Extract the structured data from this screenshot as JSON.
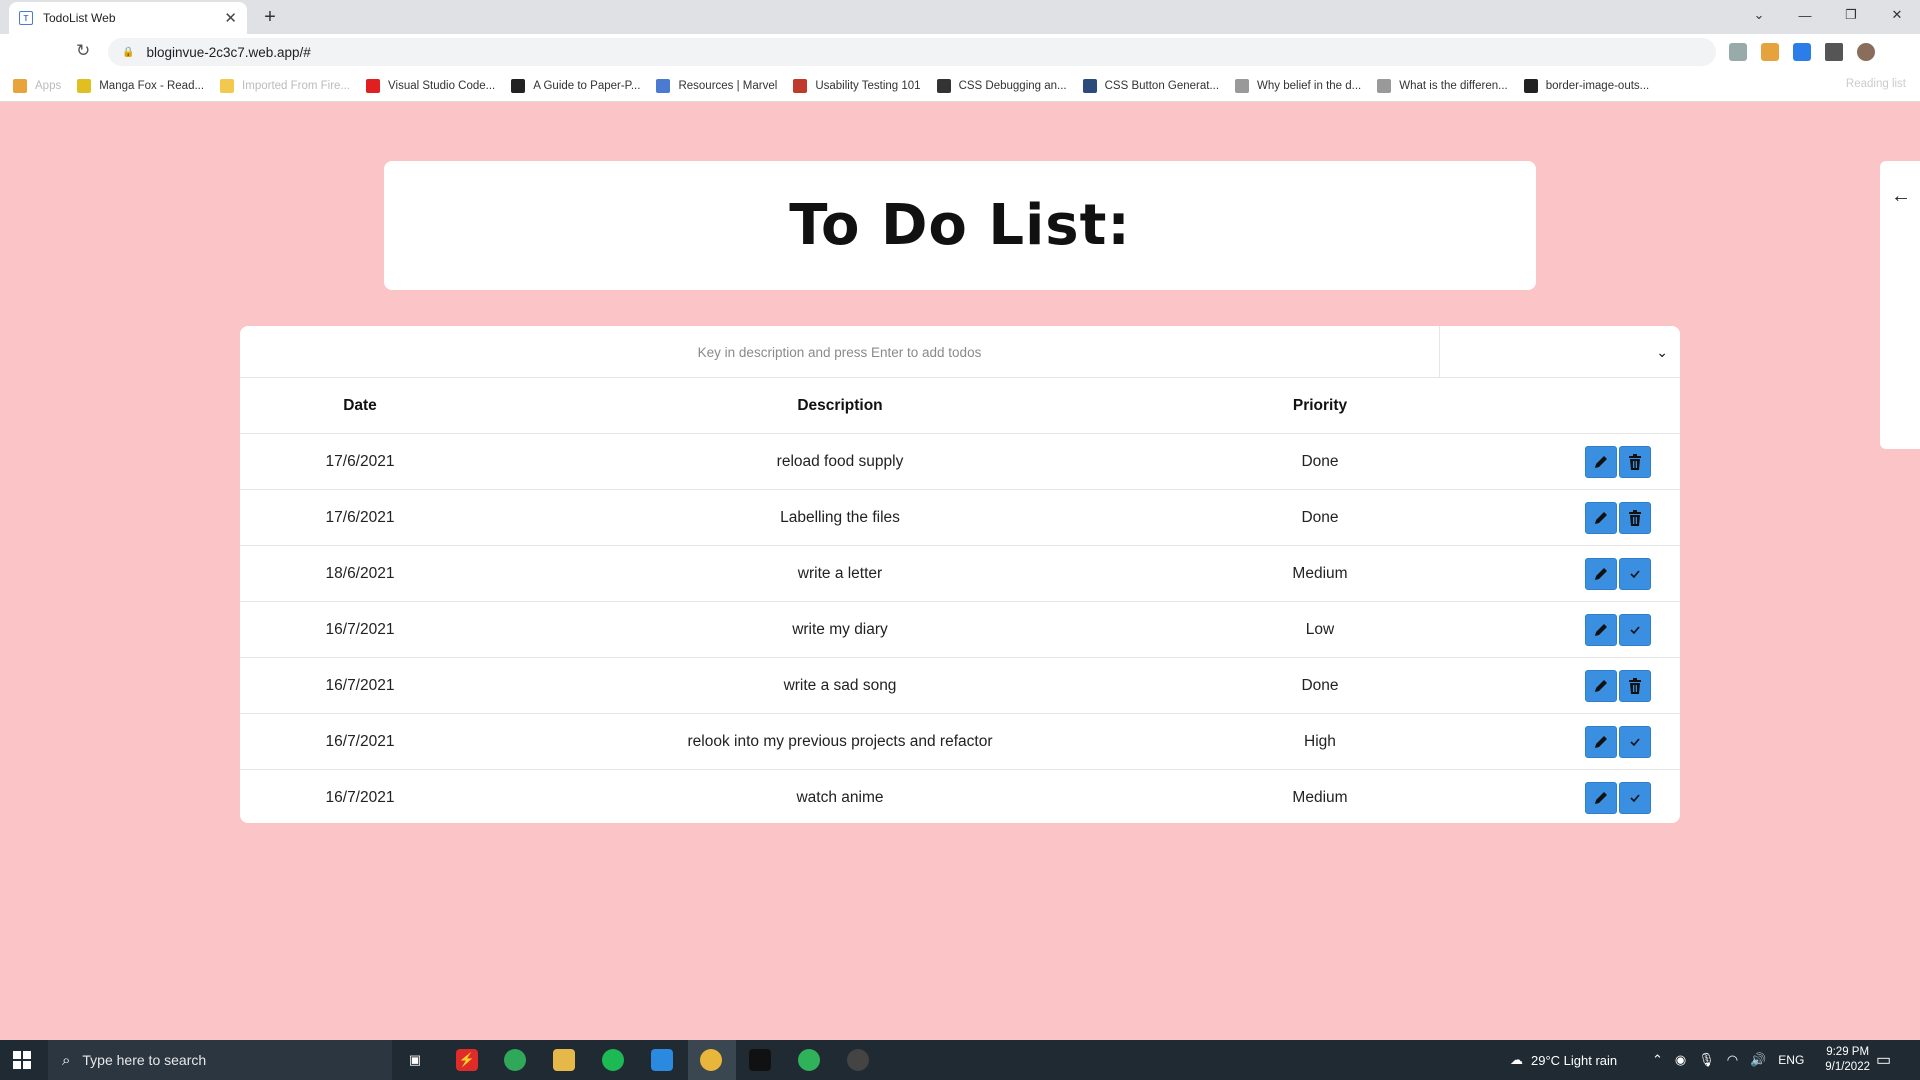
{
  "browser": {
    "tab_title": "TodoList Web",
    "url": "bloginvue-2c3c7.web.app/#",
    "bookmarks": [
      {
        "label": "Apps",
        "color": "#e8a33d",
        "faded": true
      },
      {
        "label": "Manga Fox - Read...",
        "color": "#e0c020",
        "faded": false
      },
      {
        "label": "Imported From Fire...",
        "color": "#f2c94c",
        "faded": true
      },
      {
        "label": "Visual Studio Code...",
        "color": "#e02020",
        "faded": false
      },
      {
        "label": "A Guide to Paper-P...",
        "color": "#222222",
        "faded": false
      },
      {
        "label": "Resources | Marvel",
        "color": "#4a7bd0",
        "faded": false
      },
      {
        "label": "Usability Testing 101",
        "color": "#c0392b",
        "faded": false
      },
      {
        "label": "CSS Debugging an...",
        "color": "#333333",
        "faded": false
      },
      {
        "label": "CSS Button Generat...",
        "color": "#2c4a7a",
        "faded": false
      },
      {
        "label": "Why belief in the d...",
        "color": "#999999",
        "faded": false
      },
      {
        "label": "What is the differen...",
        "color": "#999999",
        "faded": false
      },
      {
        "label": "border-image-outs...",
        "color": "#222222",
        "faded": false
      }
    ],
    "reading_list": "Reading list"
  },
  "page": {
    "heading": "To Do List:",
    "input_placeholder": "Key in description and press Enter to add todos",
    "columns": {
      "date": "Date",
      "description": "Description",
      "priority": "Priority"
    },
    "todos": [
      {
        "date": "17/6/2021",
        "description": "reload food supply",
        "priority": "Done",
        "action": "delete"
      },
      {
        "date": "17/6/2021",
        "description": "Labelling the files",
        "priority": "Done",
        "action": "delete"
      },
      {
        "date": "18/6/2021",
        "description": "write a letter",
        "priority": "Medium",
        "action": "complete"
      },
      {
        "date": "16/7/2021",
        "description": "write my diary",
        "priority": "Low",
        "action": "complete"
      },
      {
        "date": "16/7/2021",
        "description": "write a sad song",
        "priority": "Done",
        "action": "delete"
      },
      {
        "date": "16/7/2021",
        "description": "relook into my previous projects and refactor",
        "priority": "High",
        "action": "complete"
      },
      {
        "date": "16/7/2021",
        "description": "watch anime",
        "priority": "Medium",
        "action": "complete"
      }
    ]
  },
  "taskbar": {
    "search_placeholder": "Type here to search",
    "weather": "29°C  Light rain",
    "language": "ENG",
    "time": "9:29 PM",
    "date": "9/1/2022"
  },
  "colors": {
    "page_background": "#fbc4c6",
    "button_blue": "#3a8fe0"
  }
}
